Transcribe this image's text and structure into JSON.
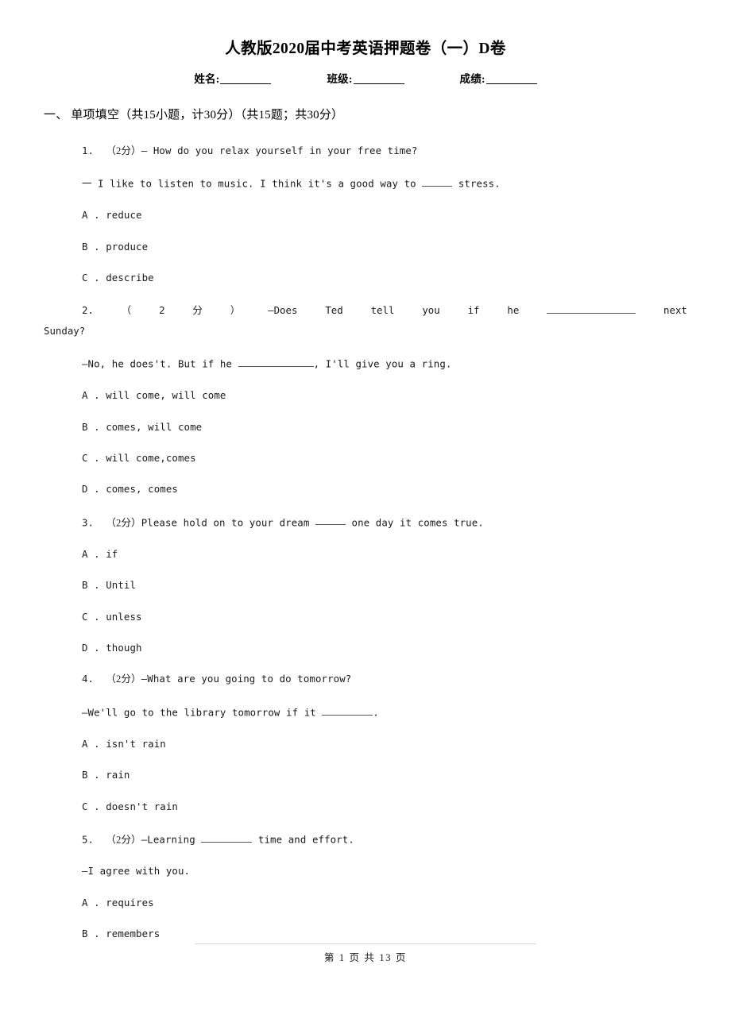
{
  "document": {
    "title": "人教版2020届中考英语押题卷（一）D卷",
    "id_fields": {
      "name_label": "姓名:",
      "class_label": "班级:",
      "score_label": "成绩:"
    },
    "section_heading": "一、 单项填空（共15小题，计30分）（共15题；共30分）",
    "footer": "第 1 页 共 13 页"
  },
  "questions": [
    {
      "number": "1.",
      "points": "（2分）",
      "stem": "— How do you relax yourself in your free time?",
      "stem_continued_pre": "一 I like to listen to music. I think it's a good way to",
      "stem_continued_post": "stress.",
      "options": [
        {
          "letter": "A .",
          "text": "reduce"
        },
        {
          "letter": "B .",
          "text": "produce"
        },
        {
          "letter": "C .",
          "text": "describe"
        }
      ]
    },
    {
      "number": "2.",
      "points_open": "（",
      "points_value": "2",
      "points_unit": "分",
      "points_close": "）",
      "justified_tokens": [
        "—Does",
        "Ted",
        "tell",
        "you",
        "if",
        "he"
      ],
      "justified_tail": "next",
      "wrapped_text": "Sunday?",
      "reply_pre": "—No, he does't. But if he",
      "reply_post": ", I'll give you a ring.",
      "options": [
        {
          "letter": "A .",
          "text": "will come, will come"
        },
        {
          "letter": "B .",
          "text": "comes, will come"
        },
        {
          "letter": "C .",
          "text": "will come,comes"
        },
        {
          "letter": "D .",
          "text": "comes, comes"
        }
      ]
    },
    {
      "number": "3.",
      "points": "（2分）",
      "stem_pre": "Please hold on to your dream",
      "stem_post": "one day it comes true.",
      "options": [
        {
          "letter": "A .",
          "text": "if"
        },
        {
          "letter": "B .",
          "text": "Until"
        },
        {
          "letter": "C .",
          "text": "unless"
        },
        {
          "letter": "D .",
          "text": "though"
        }
      ]
    },
    {
      "number": "4.",
      "points": "（2分）",
      "stem": "—What are you going to do tomorrow?",
      "reply_pre": "—We'll go to the library tomorrow if it",
      "reply_post": ".",
      "options": [
        {
          "letter": "A .",
          "text": "isn't rain"
        },
        {
          "letter": "B .",
          "text": "rain"
        },
        {
          "letter": "C .",
          "text": "doesn't rain"
        }
      ]
    },
    {
      "number": "5.",
      "points": "（2分）",
      "stem_pre": "—Learning",
      "stem_post": "time and effort.",
      "reply": "—I agree with you.",
      "options": [
        {
          "letter": "A .",
          "text": "requires"
        },
        {
          "letter": "B .",
          "text": "remembers"
        }
      ]
    }
  ]
}
